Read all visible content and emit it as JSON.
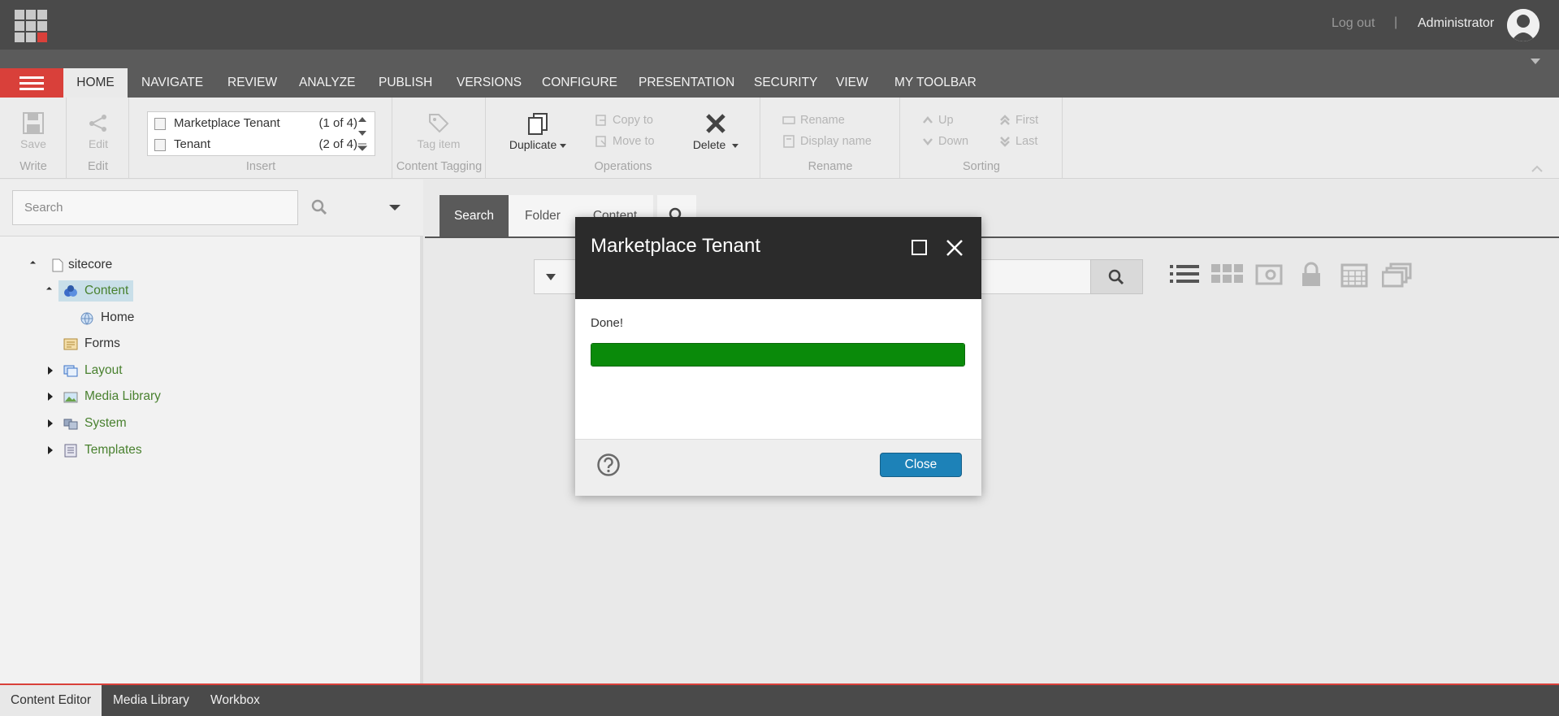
{
  "header": {
    "logout_label": "Log out",
    "separator": "|",
    "username": "Administrator"
  },
  "ribbon_tabs": [
    "HOME",
    "NAVIGATE",
    "REVIEW",
    "ANALYZE",
    "PUBLISH",
    "VERSIONS",
    "CONFIGURE",
    "PRESENTATION",
    "SECURITY",
    "VIEW",
    "MY TOOLBAR"
  ],
  "ribbon_active_tab": "HOME",
  "ribbon": {
    "write": {
      "save_label": "Save",
      "group_label": "Write"
    },
    "edit": {
      "edit_label": "Edit",
      "group_label": "Edit"
    },
    "insert": {
      "items": [
        {
          "name": "Marketplace Tenant",
          "count": "(1 of 4)"
        },
        {
          "name": "Tenant",
          "count": "(2 of 4)"
        }
      ],
      "group_label": "Insert"
    },
    "content_tagging": {
      "tag_item_label": "Tag item",
      "group_label": "Content Tagging"
    },
    "operations": {
      "duplicate_label": "Duplicate",
      "copy_to_label": "Copy to",
      "move_to_label": "Move to",
      "delete_label": "Delete",
      "group_label": "Operations"
    },
    "rename": {
      "rename_label": "Rename",
      "display_name_label": "Display name",
      "group_label": "Rename"
    },
    "sorting": {
      "up_label": "Up",
      "down_label": "Down",
      "first_label": "First",
      "last_label": "Last",
      "group_label": "Sorting"
    }
  },
  "search": {
    "placeholder": "Search"
  },
  "tree": {
    "root": "sitecore",
    "content": "Content",
    "home": "Home",
    "forms": "Forms",
    "layout": "Layout",
    "media_library": "Media Library",
    "system": "System",
    "templates": "Templates"
  },
  "right_tabs": {
    "search": "Search",
    "folder": "Folder",
    "content": "Content"
  },
  "dialog": {
    "title": "Marketplace Tenant",
    "status": "Done!",
    "progress": 1.0,
    "close_label": "Close"
  },
  "bottom_tabs": [
    "Content Editor",
    "Media Library",
    "Workbox"
  ],
  "colors": {
    "accent_red": "#d9403a",
    "progress_green": "#0a8a0a",
    "primary_button": "#1d82b8",
    "tree_green": "#49812f"
  }
}
